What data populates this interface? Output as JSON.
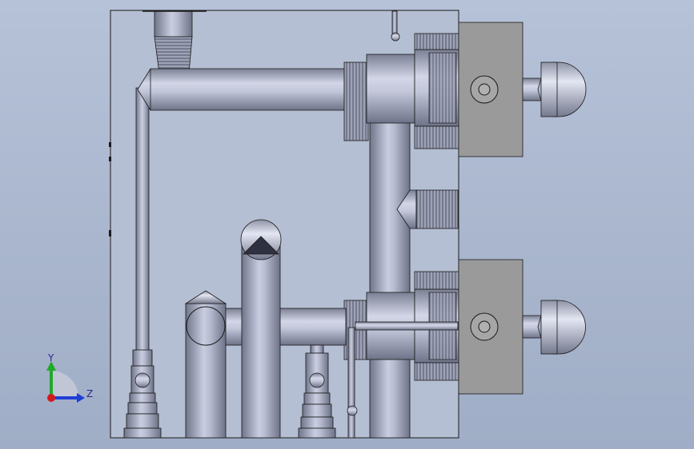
{
  "viewport": {
    "background_top": "#b6c2d8",
    "background_bottom": "#9fadc6"
  },
  "colors": {
    "metal_dark": "#6f7487",
    "metal_mid": "#a7abc0",
    "metal_light": "#d9dceb",
    "housing": "#9a9a9a",
    "outline": "#1a1a1a"
  },
  "triad": {
    "y_label": "Y",
    "z_label": "Z",
    "y_color": "#1faa2a",
    "z_color": "#1f3fd6",
    "x_color": "#d21a1a"
  },
  "icons": [
    "axis-triad-icon"
  ]
}
